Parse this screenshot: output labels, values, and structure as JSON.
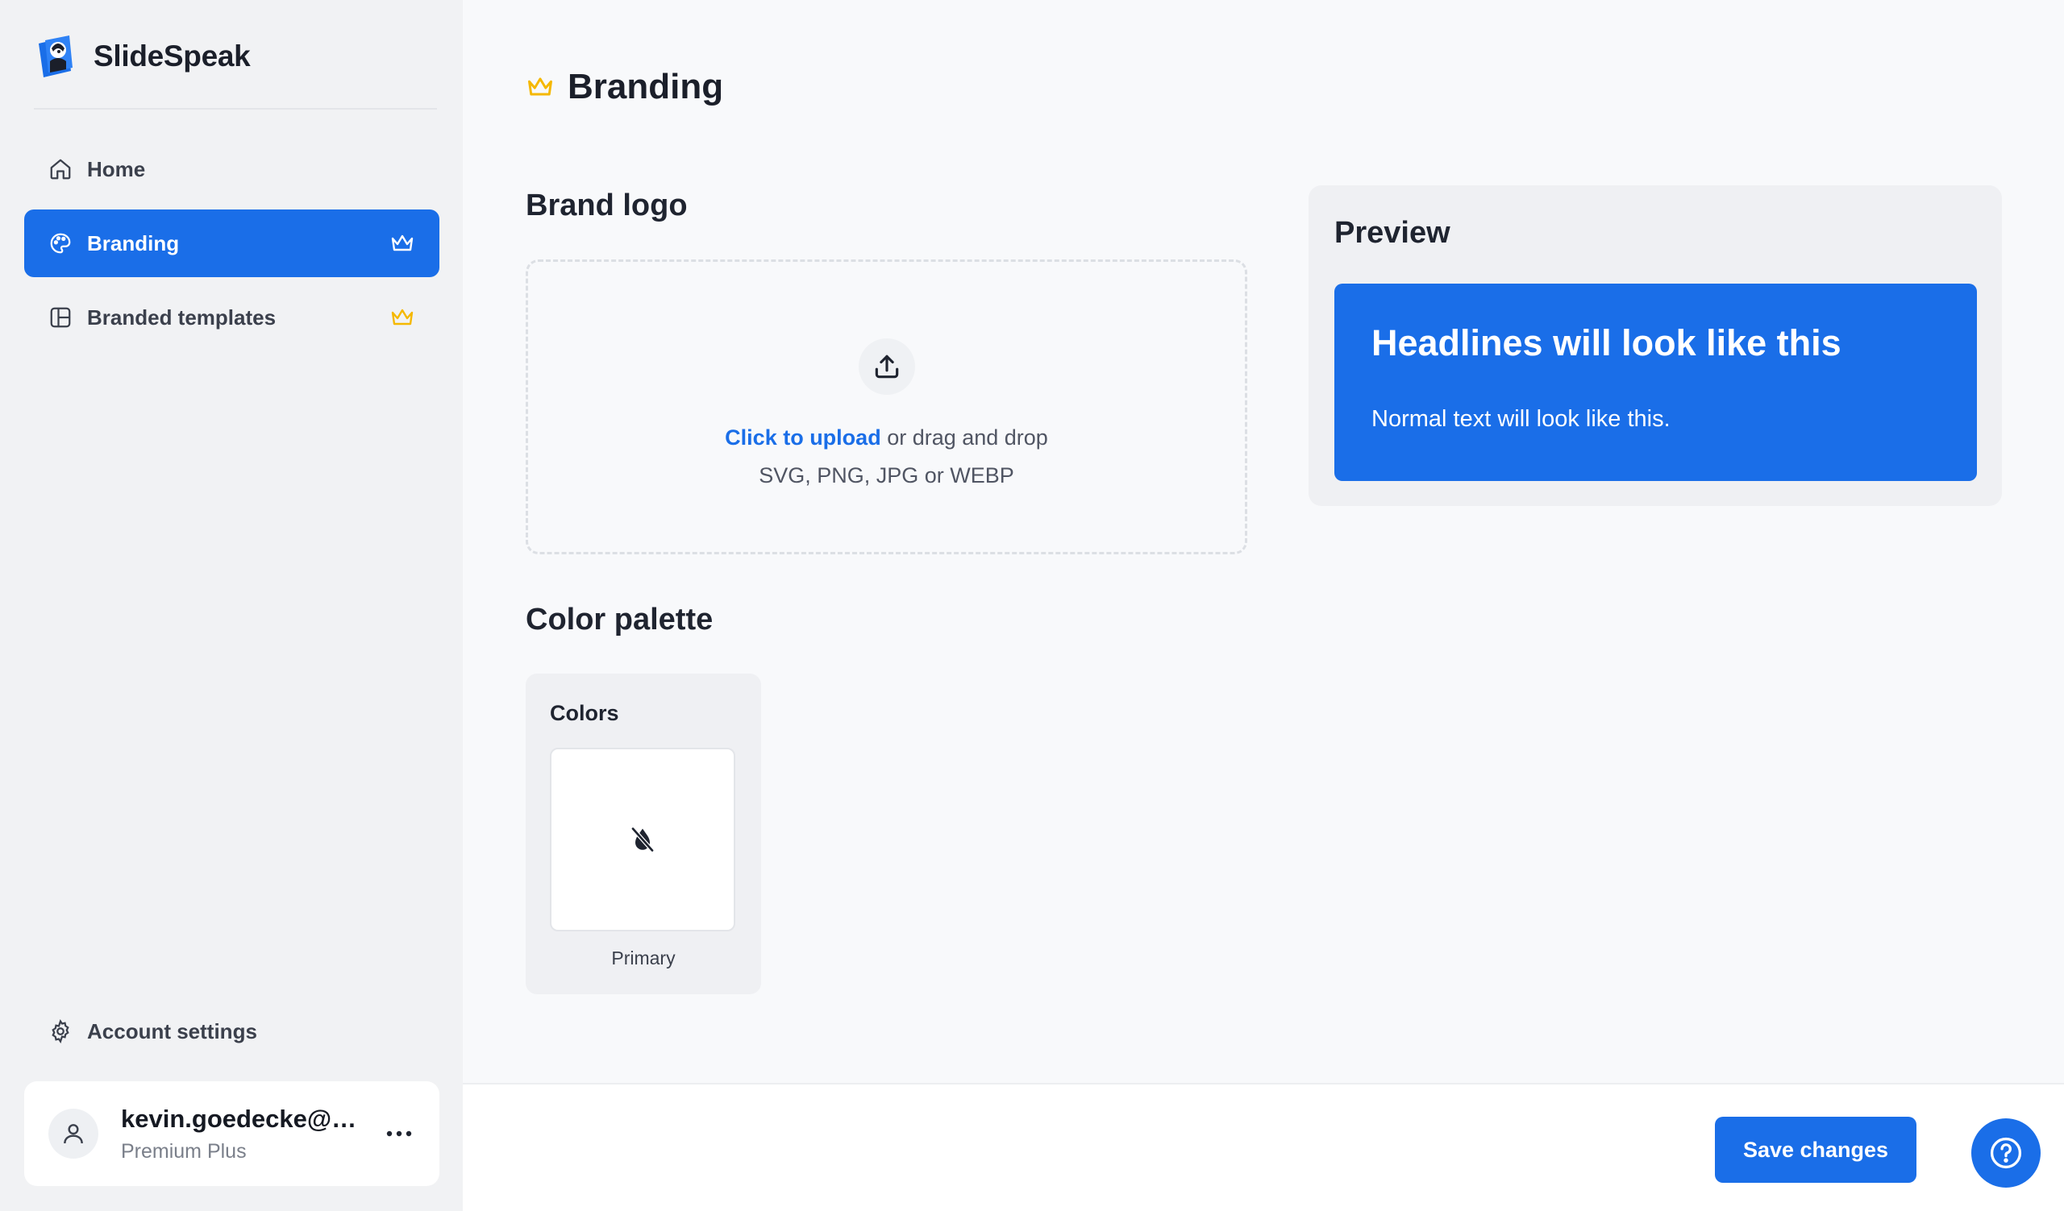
{
  "app": {
    "name": "SlideSpeak",
    "accent_color": "#1a6ee8",
    "crown_color": "#f5b800"
  },
  "sidebar": {
    "items": [
      {
        "label": "Home",
        "icon": "home-icon",
        "active": false,
        "premium": false
      },
      {
        "label": "Branding",
        "icon": "palette-icon",
        "active": true,
        "premium": true
      },
      {
        "label": "Branded templates",
        "icon": "layout-icon",
        "active": false,
        "premium": true
      }
    ],
    "account_settings": "Account settings",
    "user": {
      "email": "kevin.goedecke@g...",
      "plan": "Premium Plus"
    }
  },
  "page": {
    "title": "Branding"
  },
  "brand_logo": {
    "title": "Brand logo",
    "upload_link": "Click to upload",
    "upload_rest": " or drag and drop",
    "formats": "SVG, PNG, JPG or WEBP"
  },
  "color_palette": {
    "title": "Color palette",
    "colors_label": "Colors",
    "primary_label": "Primary"
  },
  "preview": {
    "title": "Preview",
    "headline": "Headlines will look like this",
    "body": "Normal text will look like this."
  },
  "footer": {
    "save_label": "Save changes"
  }
}
